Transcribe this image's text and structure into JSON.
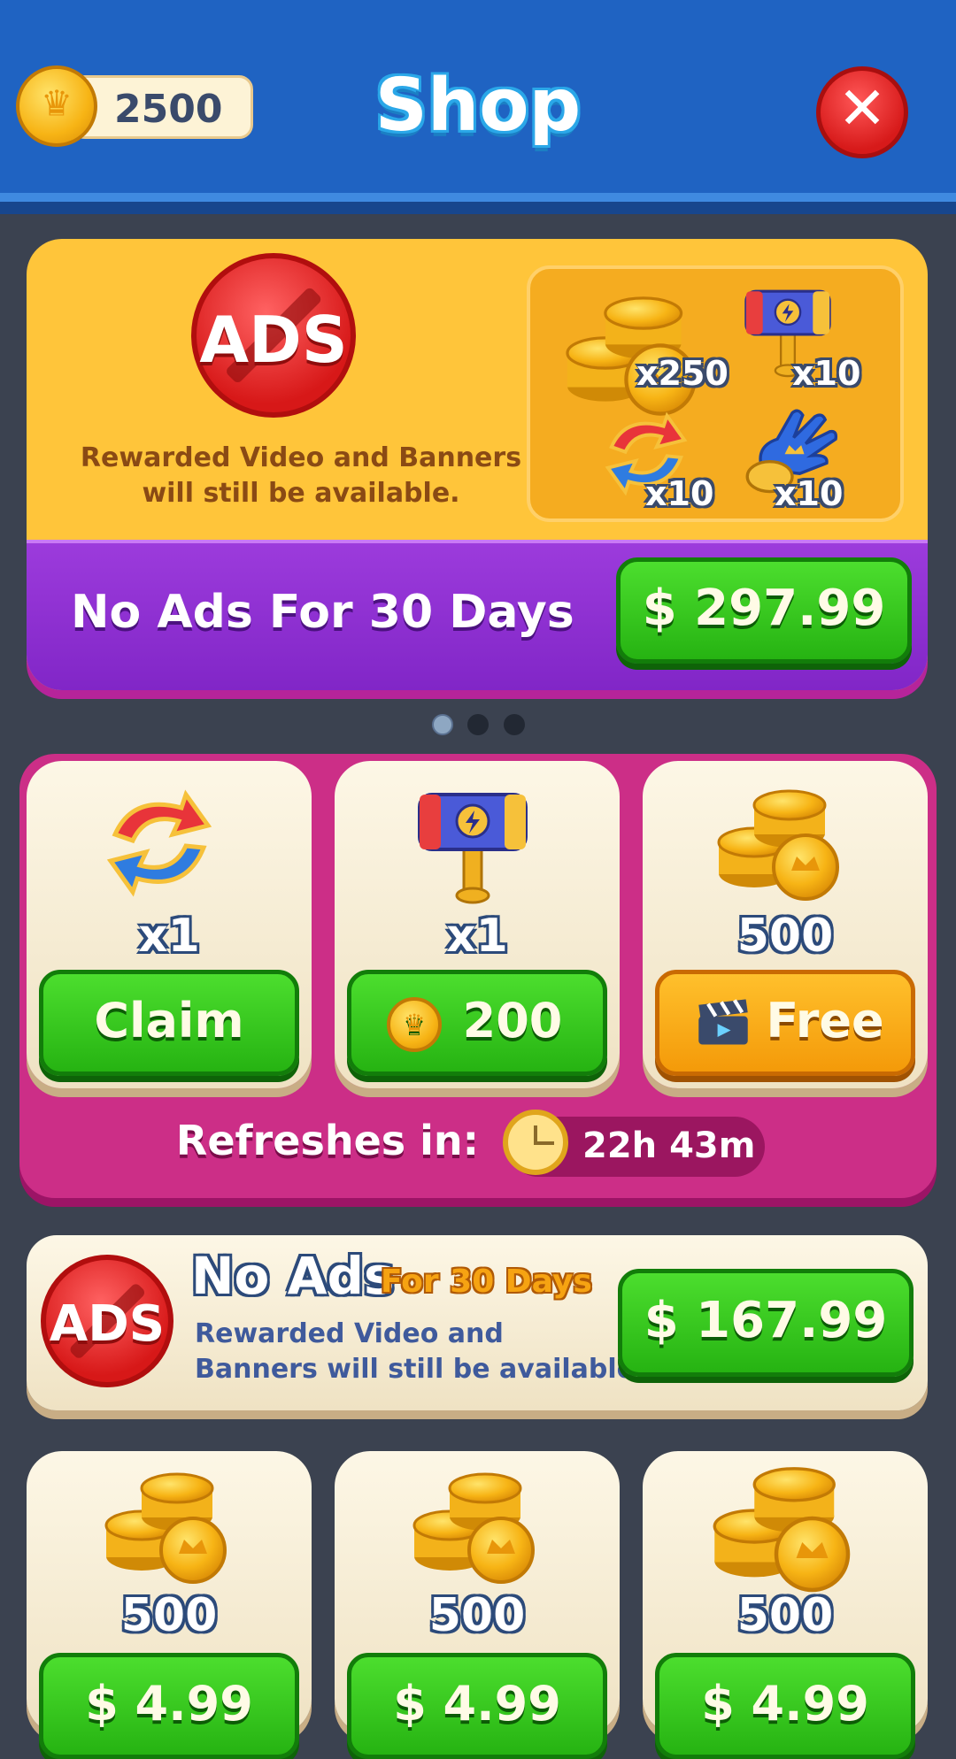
{
  "header": {
    "title": "Shop",
    "coin_balance": "2500",
    "close_icon": "close-icon"
  },
  "featured_offer": {
    "badge_text": "ADS",
    "description_line1": "Rewarded Video and Banners",
    "description_line2": "will still be available.",
    "rewards": [
      {
        "icon": "coin-stack-icon",
        "qty": "x250"
      },
      {
        "icon": "hammer-icon",
        "qty": "x10"
      },
      {
        "icon": "shuffle-icon",
        "qty": "x10"
      },
      {
        "icon": "glove-icon",
        "qty": "x10"
      }
    ],
    "label": "No Ads For 30 Days",
    "price": "$ 297.99"
  },
  "pager": {
    "count": 3,
    "active": 0
  },
  "daily_deals": {
    "cards": [
      {
        "icon": "shuffle-icon",
        "qty": "x1",
        "button": "Claim",
        "button_style": "green"
      },
      {
        "icon": "hammer-icon",
        "qty": "x1",
        "button": "200",
        "button_style": "green",
        "button_icon": "coin-icon"
      },
      {
        "icon": "coin-stack-icon",
        "qty": "500",
        "button": "Free",
        "button_style": "orange",
        "button_icon": "video-clapper-icon"
      }
    ],
    "refresh_label": "Refreshes in:",
    "refresh_time": "22h 43m"
  },
  "no_ads_small": {
    "badge_text": "ADS",
    "title": "No Ads",
    "subtitle": "For 30 Days",
    "description_line1": "Rewarded Video and",
    "description_line2": "Banners will still be available.",
    "price": "$ 167.99"
  },
  "coin_packs": [
    {
      "qty": "500",
      "price": "$ 4.99"
    },
    {
      "qty": "500",
      "price": "$ 4.99"
    },
    {
      "qty": "500",
      "price": "$ 4.99"
    }
  ],
  "colors": {
    "header_blue": "#1f63c2",
    "background": "#3b4250",
    "offer_yellow": "#ffc53a",
    "offer_purple": "#8126c7",
    "daily_pink": "#cc2e87",
    "button_green": "#26b312",
    "button_orange": "#f49a09"
  }
}
